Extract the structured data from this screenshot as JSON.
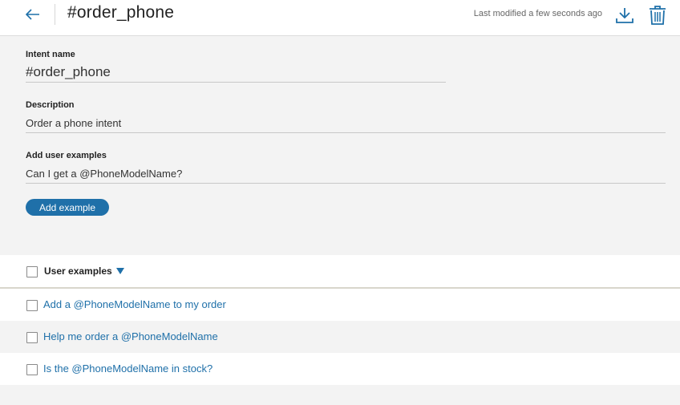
{
  "header": {
    "title": "#order_phone",
    "last_modified": "Last modified a few seconds ago"
  },
  "icons": {
    "back": "arrow-left-icon",
    "download": "download-icon",
    "delete": "trash-icon"
  },
  "colors": {
    "accent": "#1f70a9",
    "form_background": "#f3f3f3"
  },
  "form": {
    "intent_name_label": "Intent name",
    "intent_name_value": "#order_phone",
    "description_label": "Description",
    "description_value": "Order a phone intent",
    "add_examples_label": "Add user examples",
    "add_examples_value": "Can I get a @PhoneModelName?",
    "add_button": "Add example"
  },
  "examples": {
    "header_label": "User examples",
    "items": [
      "Add a @PhoneModelName to my order",
      "Help me order a @PhoneModelName",
      "Is the @PhoneModelName in stock?"
    ]
  }
}
